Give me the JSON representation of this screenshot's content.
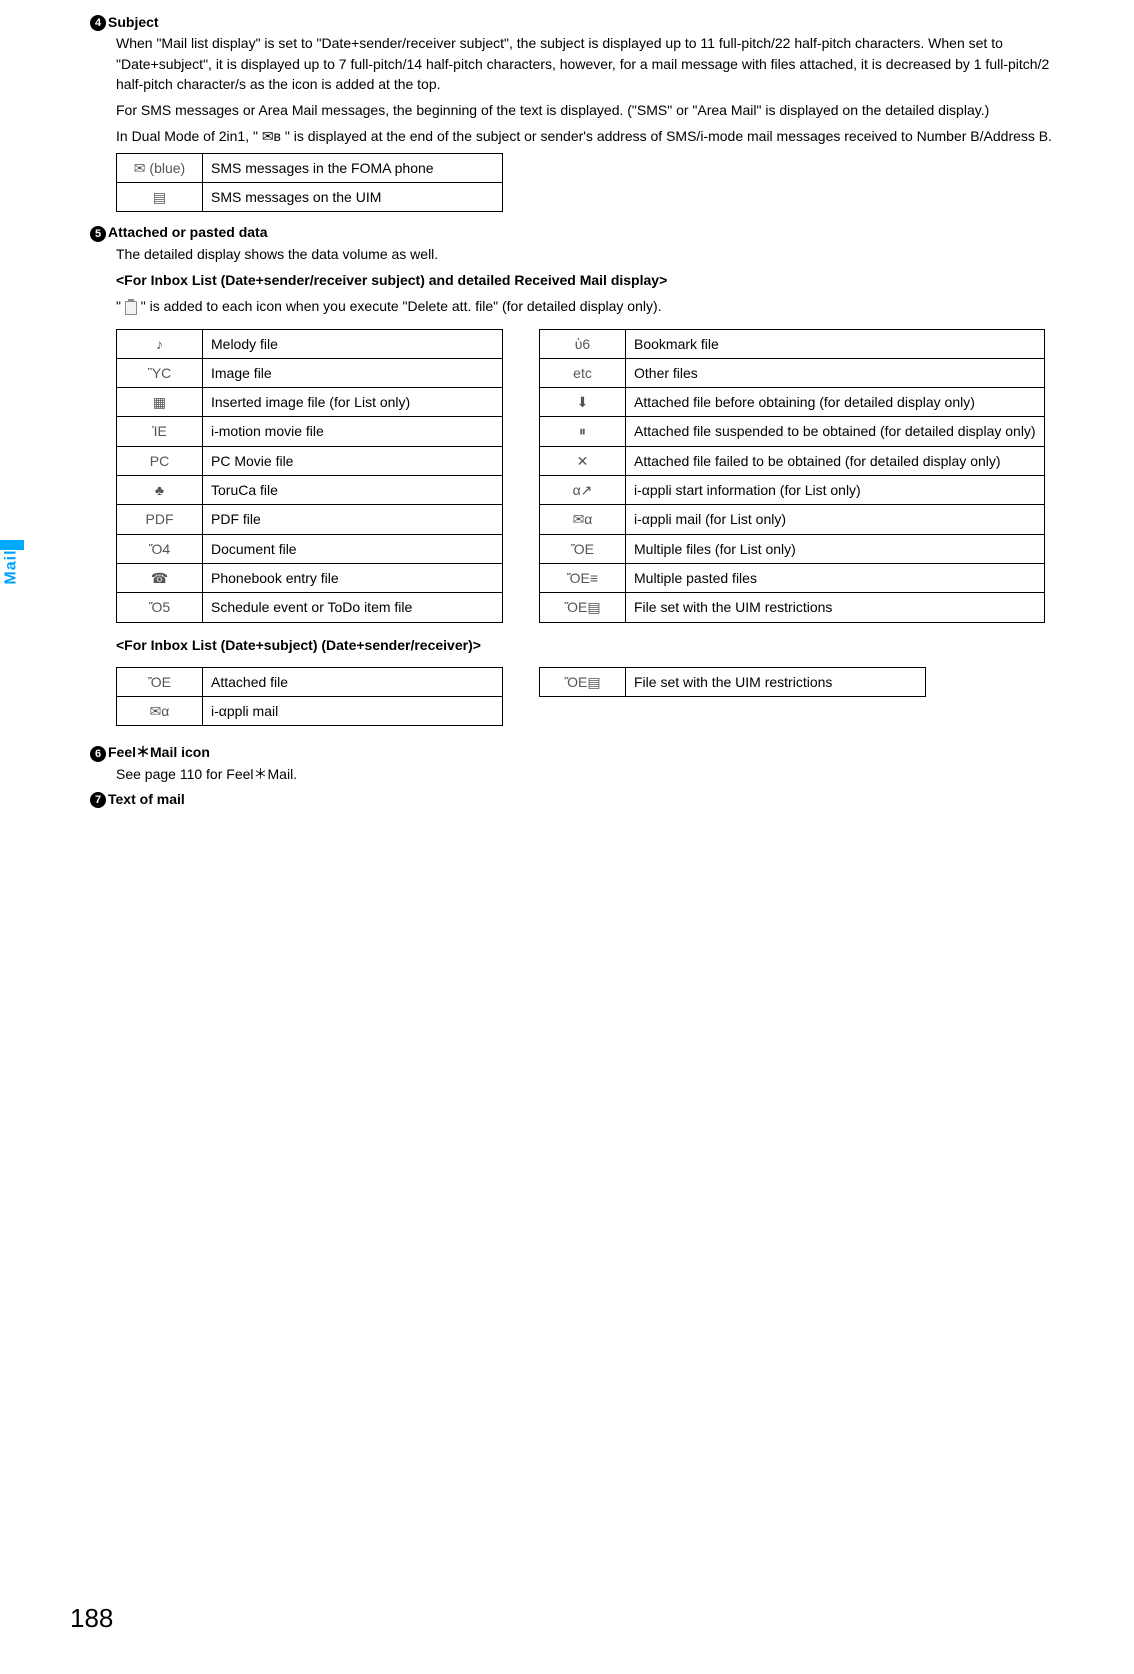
{
  "sideTab": "Mail",
  "pageNumber": "188",
  "sections": {
    "subject": {
      "num": "4",
      "title": "Subject",
      "paras": [
        "When \"Mail list display\" is set to \"Date+sender/receiver subject\", the subject is displayed up to 11 full-pitch/22 half-pitch characters. When set to \"Date+subject\", it is displayed up to 7 full-pitch/14 half-pitch characters, however, for a mail message with files attached, it is decreased by 1 full-pitch/2 half-pitch character/s as the icon is added at the top.",
        "For SMS messages or Area Mail messages, the beginning of the text is displayed. (\"SMS\" or \"Area Mail\" is displayed on the detailed display.)",
        "In Dual Mode of 2in1, \" ✉ʙ \" is displayed at the end of the subject or sender's address of SMS/i-mode mail messages received to Number B/Address B."
      ],
      "tableLeftLabel": "(blue)",
      "tableRows": [
        {
          "icon": "✉",
          "label": "SMS messages in the FOMA phone"
        },
        {
          "icon": "▤",
          "label": "SMS messages on the UIM"
        }
      ]
    },
    "attached": {
      "num": "5",
      "title": "Attached or pasted data",
      "para1": "The detailed display shows the data volume as well.",
      "subhead1": "<For Inbox List (Date+sender/receiver subject) and detailed Received Mail display>",
      "para2_pre": "\" ",
      "para2_post": " \" is added to each icon when you execute \"Delete att. file\" (for detailed display only).",
      "leftTable": [
        {
          "icon": "♪",
          "label": "Melody file"
        },
        {
          "icon": "ὛC",
          "label": "Image file"
        },
        {
          "icon": "▦",
          "label": "Inserted image file (for List only)"
        },
        {
          "icon": "ἹE",
          "label": "i-motion movie file"
        },
        {
          "icon": "PC",
          "label": "PC Movie file"
        },
        {
          "icon": "♣",
          "label": "ToruCa file"
        },
        {
          "icon": "PDF",
          "label": "PDF file"
        },
        {
          "icon": "Ὄ4",
          "label": "Document file"
        },
        {
          "icon": "☎",
          "label": "Phonebook entry file"
        },
        {
          "icon": "Ὄ5",
          "label": "Schedule event or ToDo item file"
        }
      ],
      "rightTable": [
        {
          "icon": "ὑ6",
          "label": "Bookmark file"
        },
        {
          "icon": "etc",
          "label": "Other files"
        },
        {
          "icon": "⬇",
          "label": "Attached file before obtaining (for detailed display only)"
        },
        {
          "icon": "⏸",
          "label": "Attached file suspended to be obtained (for detailed display only)"
        },
        {
          "icon": "✕",
          "label": "Attached file failed to be obtained (for detailed display only)"
        },
        {
          "icon": "α↗",
          "label": "i-αppli start information (for List only)"
        },
        {
          "icon": "✉α",
          "label": "i-αppli mail (for List only)"
        },
        {
          "icon": "ὌE",
          "label": "Multiple files (for List only)"
        },
        {
          "icon": "ὌE≡",
          "label": "Multiple pasted files"
        },
        {
          "icon": "ὌE▤",
          "label": "File set with the UIM restrictions"
        }
      ],
      "subhead2": "<For Inbox List (Date+subject) (Date+sender/receiver)>",
      "leftTable2": [
        {
          "icon": "ὌE",
          "label": "Attached file"
        },
        {
          "icon": "✉α",
          "label": "i-αppli mail"
        }
      ],
      "rightTable2": [
        {
          "icon": "ὌE▤",
          "label": "File set with the UIM restrictions"
        }
      ]
    },
    "feel": {
      "num": "6",
      "title": "Feel＊Mail icon",
      "para": "See page 110 for Feel＊Mail."
    },
    "text": {
      "num": "7",
      "title": "Text of mail"
    }
  }
}
